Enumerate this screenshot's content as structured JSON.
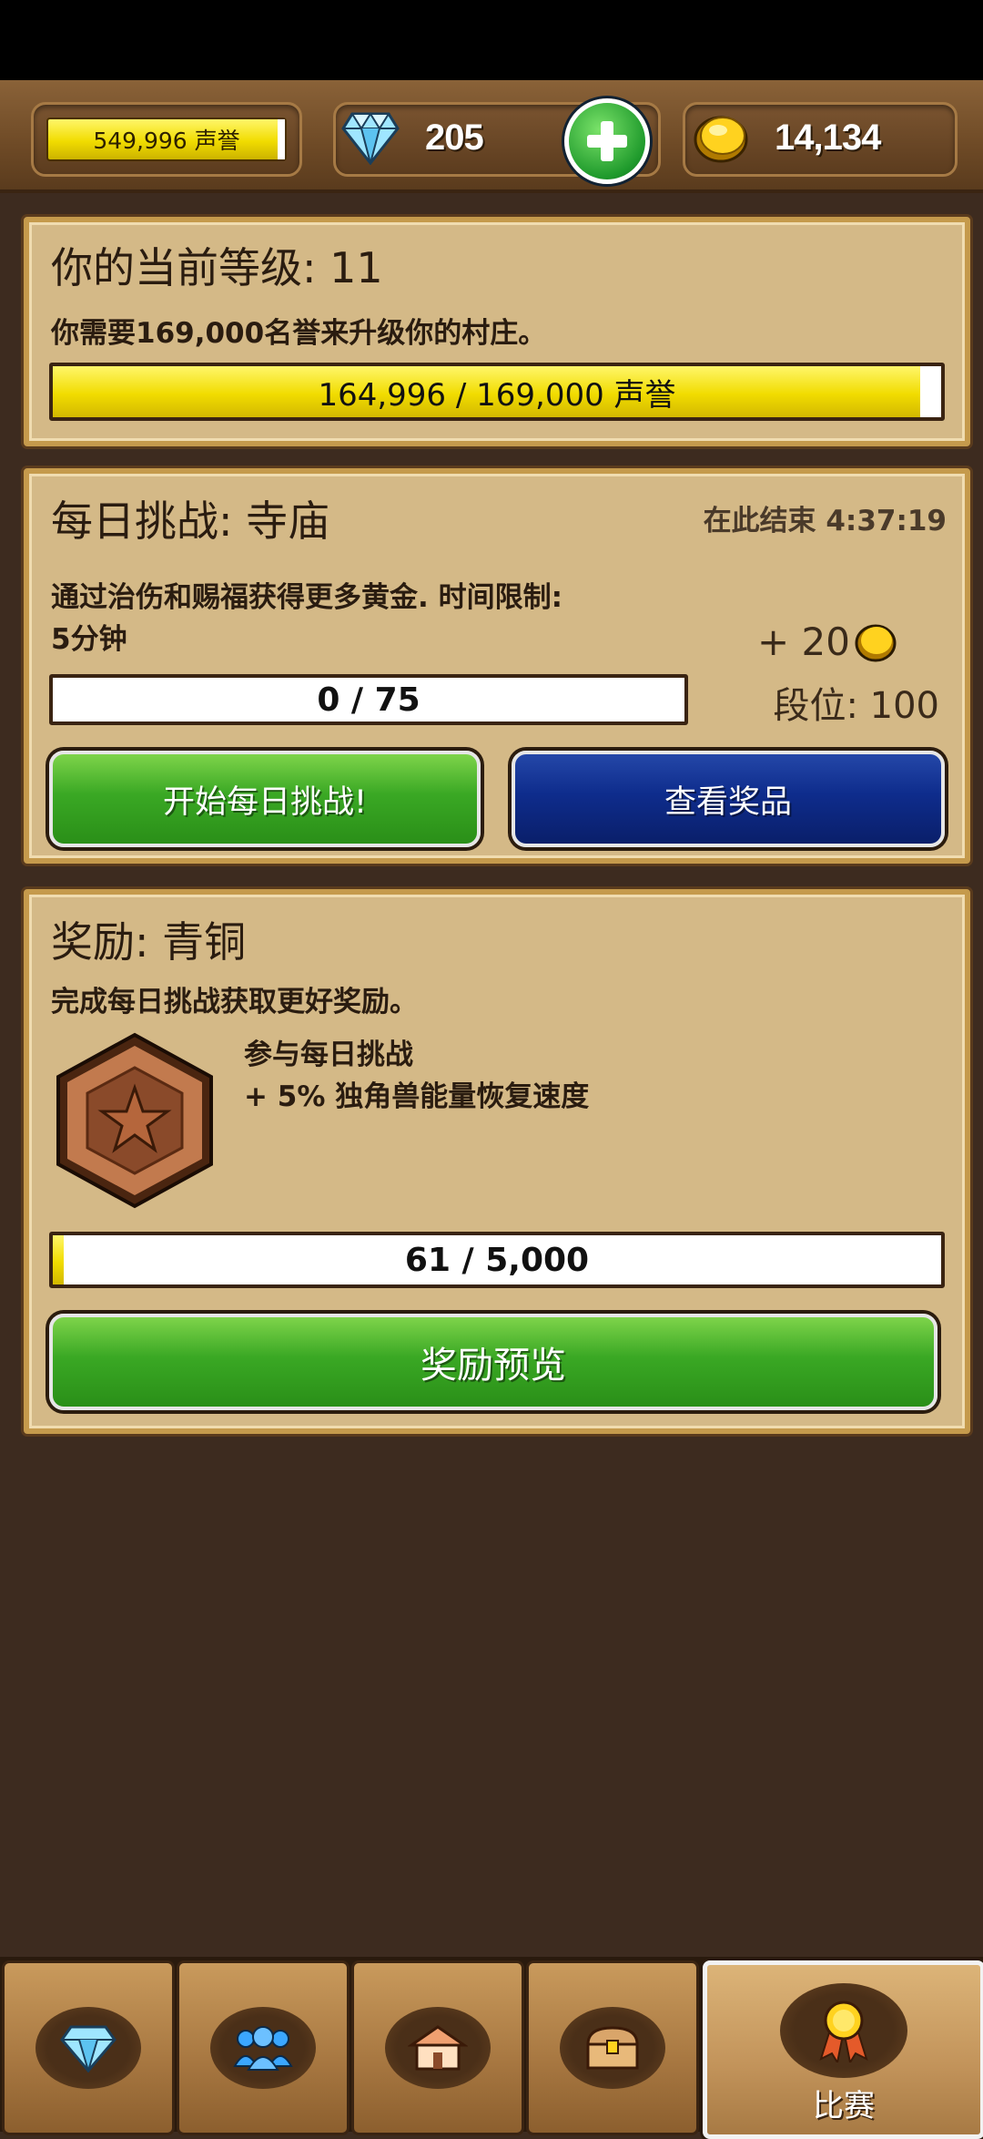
{
  "topbar": {
    "fame_label": "549,996 声誉",
    "gems": "205",
    "gold": "14,134"
  },
  "level_panel": {
    "title": "你的当前等级: 11",
    "description": "你需要169,000名誉来升级你的村庄。",
    "progress_text": "164,996 / 169,000 声誉",
    "progress_fraction": 0.976
  },
  "daily_panel": {
    "title": "每日挑战: 寺庙",
    "ends_text": "在此结束 4:37:19",
    "description_line1": "通过治伤和赐福获得更多黄金. 时间限制:",
    "description_line2": "5分钟",
    "reward_text": "+ 20",
    "rank_text": "段位: 100",
    "progress_text": "0 / 75",
    "progress_fraction": 0,
    "start_button": "开始每日挑战!",
    "prizes_button": "查看奖品"
  },
  "reward_panel": {
    "title": "奖励: 青铜",
    "description": "完成每日挑战获取更好奖励。",
    "bonus_line1": "参与每日挑战",
    "bonus_line2": "+ 5% 独角兽能量恢复速度",
    "progress_text": "61 / 5,000",
    "progress_fraction": 0.012,
    "preview_button": "奖励预览"
  },
  "navbar": {
    "tabs": [
      {
        "icon": "gem-icon"
      },
      {
        "icon": "people-icon"
      },
      {
        "icon": "village-icon"
      },
      {
        "icon": "chest-icon"
      },
      {
        "icon": "medal-icon",
        "label": "比赛",
        "active": true
      }
    ]
  },
  "colors": {
    "background": "#3d2b1f",
    "panel": "#d4b987",
    "green_button": "#3aa824",
    "blue_button": "#0e2c8c",
    "fame_yellow": "#f1dc00"
  }
}
